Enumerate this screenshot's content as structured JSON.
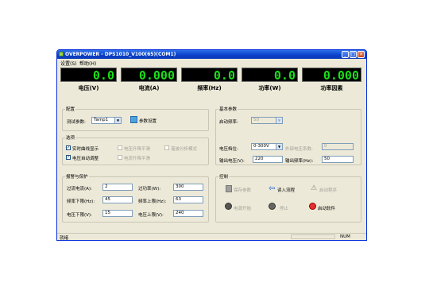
{
  "window": {
    "title": "OVERPOWER - DPS1010_V100(65)(COM1)"
  },
  "menu": {
    "items": [
      "设置(S)",
      "帮助(H)"
    ]
  },
  "meters": [
    {
      "value": "0.0",
      "unit": "电压(V)"
    },
    {
      "value": "0.000",
      "unit": "电流(A)"
    },
    {
      "value": "0.0",
      "unit": "频率(Hz)"
    },
    {
      "value": "0.0",
      "unit": "功率(W)"
    },
    {
      "value": "0.000",
      "unit": "功率因素"
    }
  ],
  "config": {
    "group_title": "配置",
    "model_label": "测试参数:",
    "model_value": "Tamp1",
    "save_label": "参数设置"
  },
  "options": {
    "group_title": "选项",
    "items": [
      "实时曲线显示",
      "电压自动调整",
      "电压升降平滑",
      "电流升降平滑",
      "谐波分析模式"
    ]
  },
  "fixed": {
    "group_title": "基本参数",
    "freq_label": "启动频率:",
    "freq_value": "50",
    "range_label": "电压档位:",
    "range_value": "0-300V",
    "ext_label": "外部电压系数:",
    "ext_value": "0",
    "out_v_label": "输出电压(V):",
    "out_v_value": "220",
    "out_f_label": "输出频率(Hz):",
    "out_f_value": "50"
  },
  "protect": {
    "group_title": "报警与保护",
    "rows": [
      {
        "l1": "过流电流(A):",
        "v1": "2",
        "l2": "过功率(W):",
        "v2": "300"
      },
      {
        "l1": "频率下限(Hz):",
        "v1": "45",
        "l2": "频率上限(Hz):",
        "v2": "63"
      },
      {
        "l1": "电压下限(V):",
        "v1": "15",
        "l2": "电压上限(V):",
        "v2": "240"
      }
    ]
  },
  "control": {
    "group_title": "控制",
    "buttons": [
      "保存参数",
      "读入流程",
      "启动程序",
      "电源开始",
      "停止",
      "启动软件"
    ]
  },
  "status": {
    "left": "就绪",
    "right": "NUM"
  }
}
